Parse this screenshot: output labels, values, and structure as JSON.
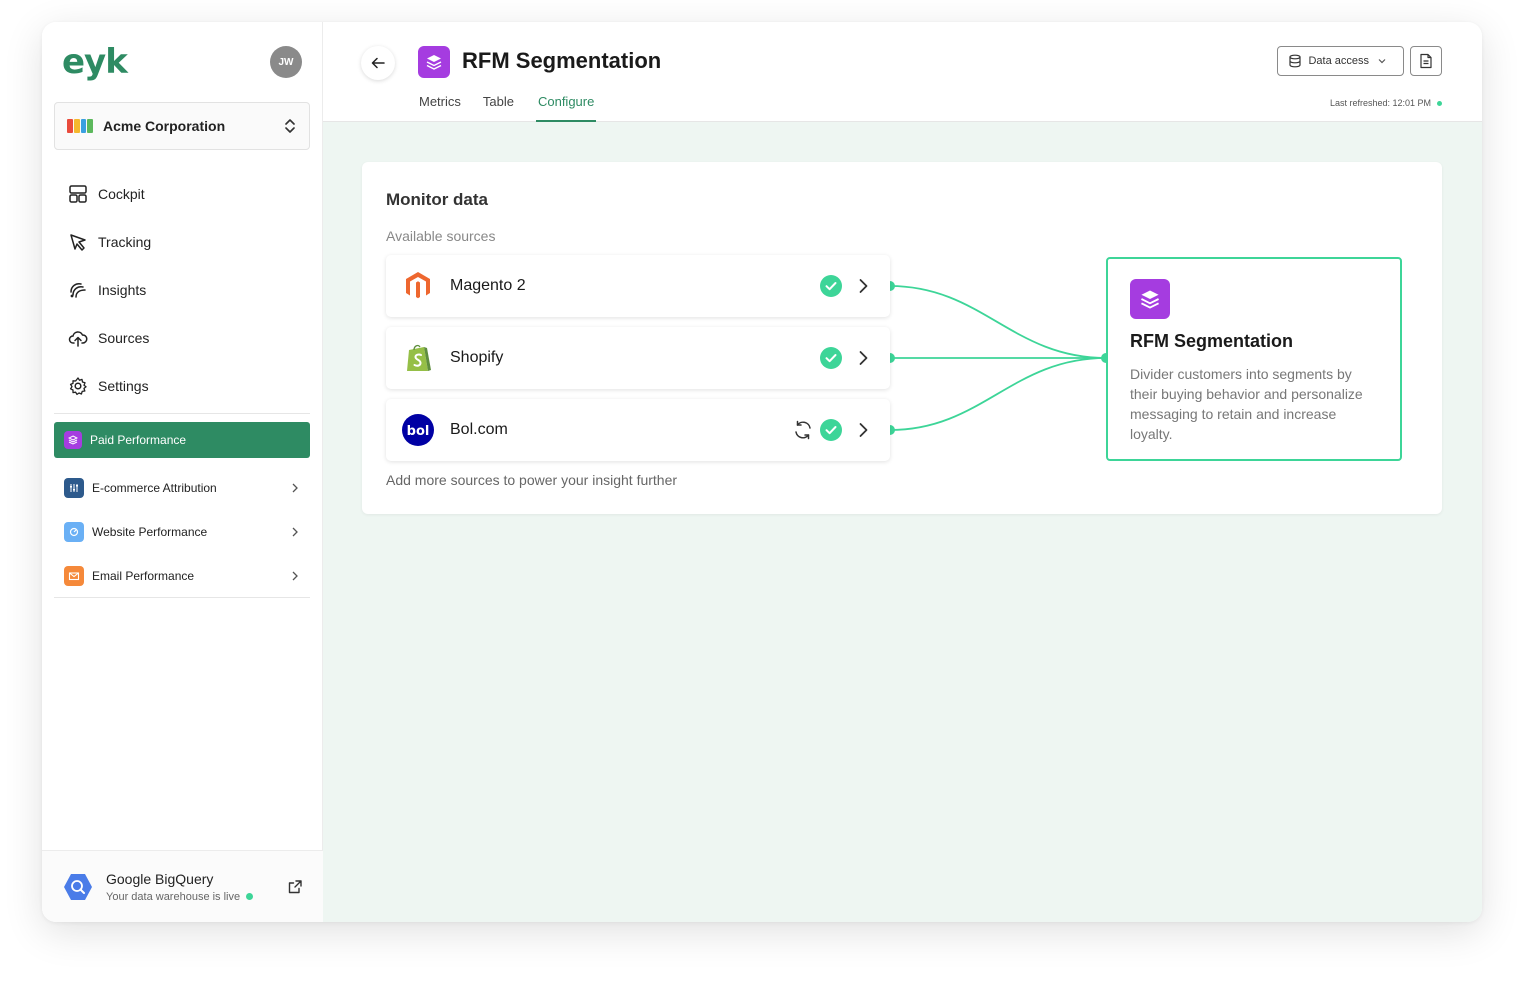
{
  "sidebar": {
    "logo": "eyk",
    "avatar_initials": "JW",
    "org_name": "Acme Corporation",
    "nav": [
      {
        "label": "Cockpit",
        "icon": "layout-icon"
      },
      {
        "label": "Tracking",
        "icon": "cursor-icon"
      },
      {
        "label": "Insights",
        "icon": "insights-icon"
      },
      {
        "label": "Sources",
        "icon": "cloud-upload-icon"
      },
      {
        "label": "Settings",
        "icon": "gear-icon"
      }
    ],
    "insights": [
      {
        "label": "Paid Performance",
        "active": true,
        "icon_color": "#a53ce0"
      },
      {
        "label": "E-commerce Attribution",
        "icon_color": "#2d5a8c"
      },
      {
        "label": "Website Performance",
        "icon_color": "#6ab0f5"
      },
      {
        "label": "Email Performance",
        "icon_color": "#f5893a"
      }
    ],
    "warehouse": {
      "title": "Google BigQuery",
      "status": "Your data warehouse is live"
    }
  },
  "header": {
    "title": "RFM Segmentation",
    "tabs": [
      "Metrics",
      "Table",
      "Configure"
    ],
    "active_tab": "Configure",
    "data_access_label": "Data access",
    "last_refreshed": "Last refreshed: 12:01 PM"
  },
  "card": {
    "title": "Monitor data",
    "subtitle": "Available sources",
    "sources": [
      {
        "name": "Magento 2",
        "syncing": false
      },
      {
        "name": "Shopify",
        "syncing": false
      },
      {
        "name": "Bol.com",
        "syncing": true
      }
    ],
    "footer": "Add more sources to power your insight further",
    "target": {
      "title": "RFM Segmentation",
      "description": "Divider customers into segments by their buying behavior and personalize messaging to retain and increase loyalty."
    }
  },
  "colors": {
    "brand_green": "#2e8b63",
    "accent_mint": "#3dd598",
    "insight_purple": "#a53ce0"
  }
}
